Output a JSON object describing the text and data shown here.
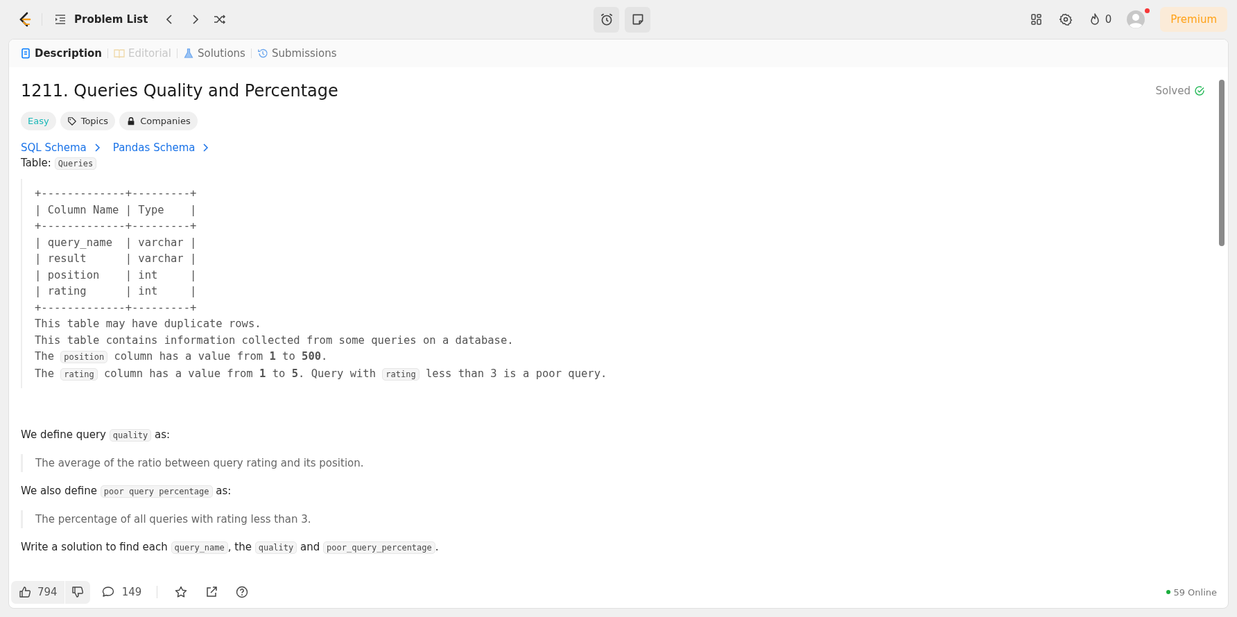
{
  "nav": {
    "title": "Problem List"
  },
  "streak": {
    "count": "0"
  },
  "premium": {
    "label": "Premium"
  },
  "avatar": {
    "notification": true
  },
  "tabs": [
    {
      "label": "Description",
      "selected": true,
      "disabled": false
    },
    {
      "label": "Editorial",
      "selected": false,
      "disabled": true
    },
    {
      "label": "Solutions",
      "selected": false,
      "disabled": false
    },
    {
      "label": "Submissions",
      "selected": false,
      "disabled": false
    }
  ],
  "problem": {
    "title": "1211. Queries Quality and Percentage",
    "status": "Solved",
    "solved": true
  },
  "tags": [
    {
      "kind": "difficulty",
      "label": "Easy"
    },
    {
      "kind": "topics",
      "label": "Topics"
    },
    {
      "kind": "companies",
      "label": "Companies"
    }
  ],
  "schema_links": [
    "SQL Schema",
    "Pandas Schema"
  ],
  "table_intro": [
    {
      "kind": "text",
      "text": "Table:"
    },
    {
      "kind": "code",
      "text": "Queries"
    }
  ],
  "code_table": [
    "+-------------+---------+",
    "| Column Name | Type    |",
    "+-------------+---------+",
    "| query_name  | varchar |",
    "| result      | varchar |",
    "| position    | int     |",
    "| rating      | int     |",
    "+-------------+---------+"
  ],
  "code_notes": [
    [
      {
        "kind": "text",
        "text": "This table may have duplicate rows."
      }
    ],
    [
      {
        "kind": "text",
        "text": "This table contains information collected from some queries on a database."
      }
    ],
    [
      {
        "kind": "text",
        "text": "The "
      },
      {
        "kind": "code",
        "text": "position"
      },
      {
        "kind": "text",
        "text": " column has a value from **1** to **500**."
      }
    ],
    [
      {
        "kind": "text",
        "text": "The "
      },
      {
        "kind": "code",
        "text": "rating"
      },
      {
        "kind": "text",
        "text": " column has a value from **1** to **5**. Query with "
      },
      {
        "kind": "code",
        "text": "rating"
      },
      {
        "kind": "text",
        "text": " less than 3 is a poor query."
      }
    ]
  ],
  "body": [
    {
      "kind": "paragraph",
      "parts": [
        {
          "kind": "text",
          "text": "We define query "
        },
        {
          "kind": "code",
          "text": "quality"
        },
        {
          "kind": "text",
          "text": " as:"
        }
      ]
    },
    {
      "kind": "quote",
      "parts": [
        {
          "kind": "text",
          "text": "The average of the ratio between query rating and its position."
        }
      ]
    },
    {
      "kind": "paragraph",
      "parts": [
        {
          "kind": "text",
          "text": "We also define "
        },
        {
          "kind": "code",
          "text": "poor query percentage"
        },
        {
          "kind": "text",
          "text": " as:"
        }
      ]
    },
    {
      "kind": "quote",
      "parts": [
        {
          "kind": "text",
          "text": "The percentage of all queries with rating less than 3."
        }
      ]
    },
    {
      "kind": "paragraph",
      "parts": [
        {
          "kind": "text",
          "text": "Write a solution to find each "
        },
        {
          "kind": "code",
          "text": "query_name"
        },
        {
          "kind": "text",
          "text": ", the "
        },
        {
          "kind": "code",
          "text": "quality"
        },
        {
          "kind": "text",
          "text": " and "
        },
        {
          "kind": "code",
          "text": "poor_query_percentage"
        },
        {
          "kind": "text",
          "text": "."
        }
      ]
    }
  ],
  "footer": {
    "likes": "794",
    "comments": "149",
    "online": "59 Online"
  }
}
